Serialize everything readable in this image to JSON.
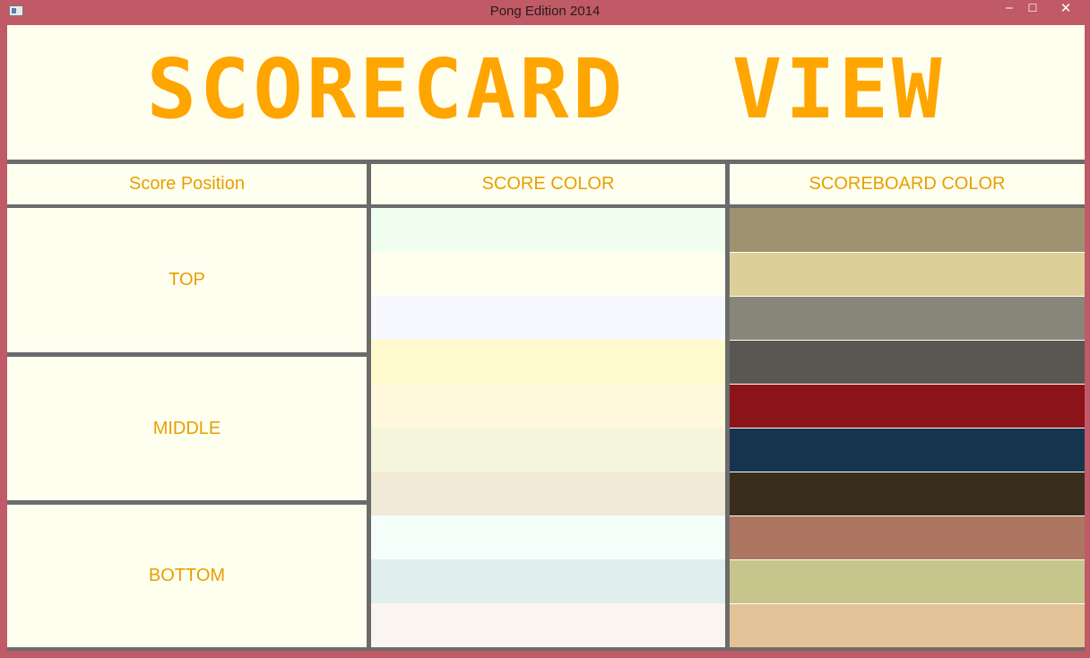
{
  "window": {
    "title": "Pong Edition 2014",
    "minimize_glyph": "‒",
    "maximize_glyph": "☐",
    "close_glyph": "✕"
  },
  "header": {
    "title": "SCORECARD  VIEW",
    "title_color": "#ffa500"
  },
  "columns": {
    "position": "Score Position",
    "score_color": "SCORE COLOR",
    "scoreboard_color": "SCOREBOARD COLOR"
  },
  "positions": [
    "TOP",
    "MIDDLE",
    "BOTTOM"
  ],
  "score_colors": [
    "#f0fff0",
    "#fffff0",
    "#f8f8ff",
    "#fffacd",
    "#fff8dc",
    "#f5f5dc",
    "#f0ead6",
    "#f5fffa",
    "#e0eeee",
    "#faf5f0"
  ],
  "scoreboard_colors": [
    "#9e9370",
    "#dcd098",
    "#888579",
    "#5a5652",
    "#8b1419",
    "#17344f",
    "#392d1c",
    "#ac7660",
    "#c6c58b",
    "#e4c297"
  ],
  "colors": {
    "window_frame": "#c05a66",
    "background": "#fffff0",
    "text_accent": "#e6a000",
    "grid_line": "#6b6b6b"
  }
}
